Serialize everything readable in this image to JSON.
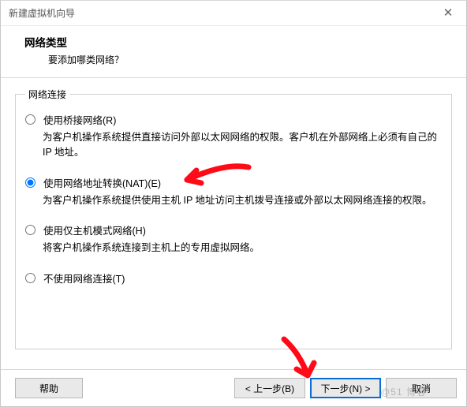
{
  "titlebar": {
    "title": "新建虚拟机向导",
    "close_tip": "✕"
  },
  "header": {
    "title": "网络类型",
    "subtitle": "要添加哪类网络？"
  },
  "group": {
    "legend": "网络连接",
    "options": [
      {
        "id": "opt-bridged",
        "label": "使用桥接网络(R)",
        "desc": "为客户机操作系统提供直接访问外部以太网网络的权限。客户机在外部网络上必须有自己的 IP 地址。",
        "checked": false
      },
      {
        "id": "opt-nat",
        "label": "使用网络地址转换(NAT)(E)",
        "desc": "为客户机操作系统提供使用主机 IP 地址访问主机拨号连接或外部以太网网络连接的权限。",
        "checked": true
      },
      {
        "id": "opt-hostonly",
        "label": "使用仅主机模式网络(H)",
        "desc": "将客户机操作系统连接到主机上的专用虚拟网络。",
        "checked": false
      },
      {
        "id": "opt-none",
        "label": "不使用网络连接(T)",
        "desc": "",
        "checked": false
      }
    ]
  },
  "footer": {
    "help": "帮助",
    "back": "< 上一步(B)",
    "next": "下一步(N) >",
    "cancel": "取消"
  },
  "watermark": "@51   博客",
  "annotations": {
    "arrow_color": "#ff0a16"
  }
}
